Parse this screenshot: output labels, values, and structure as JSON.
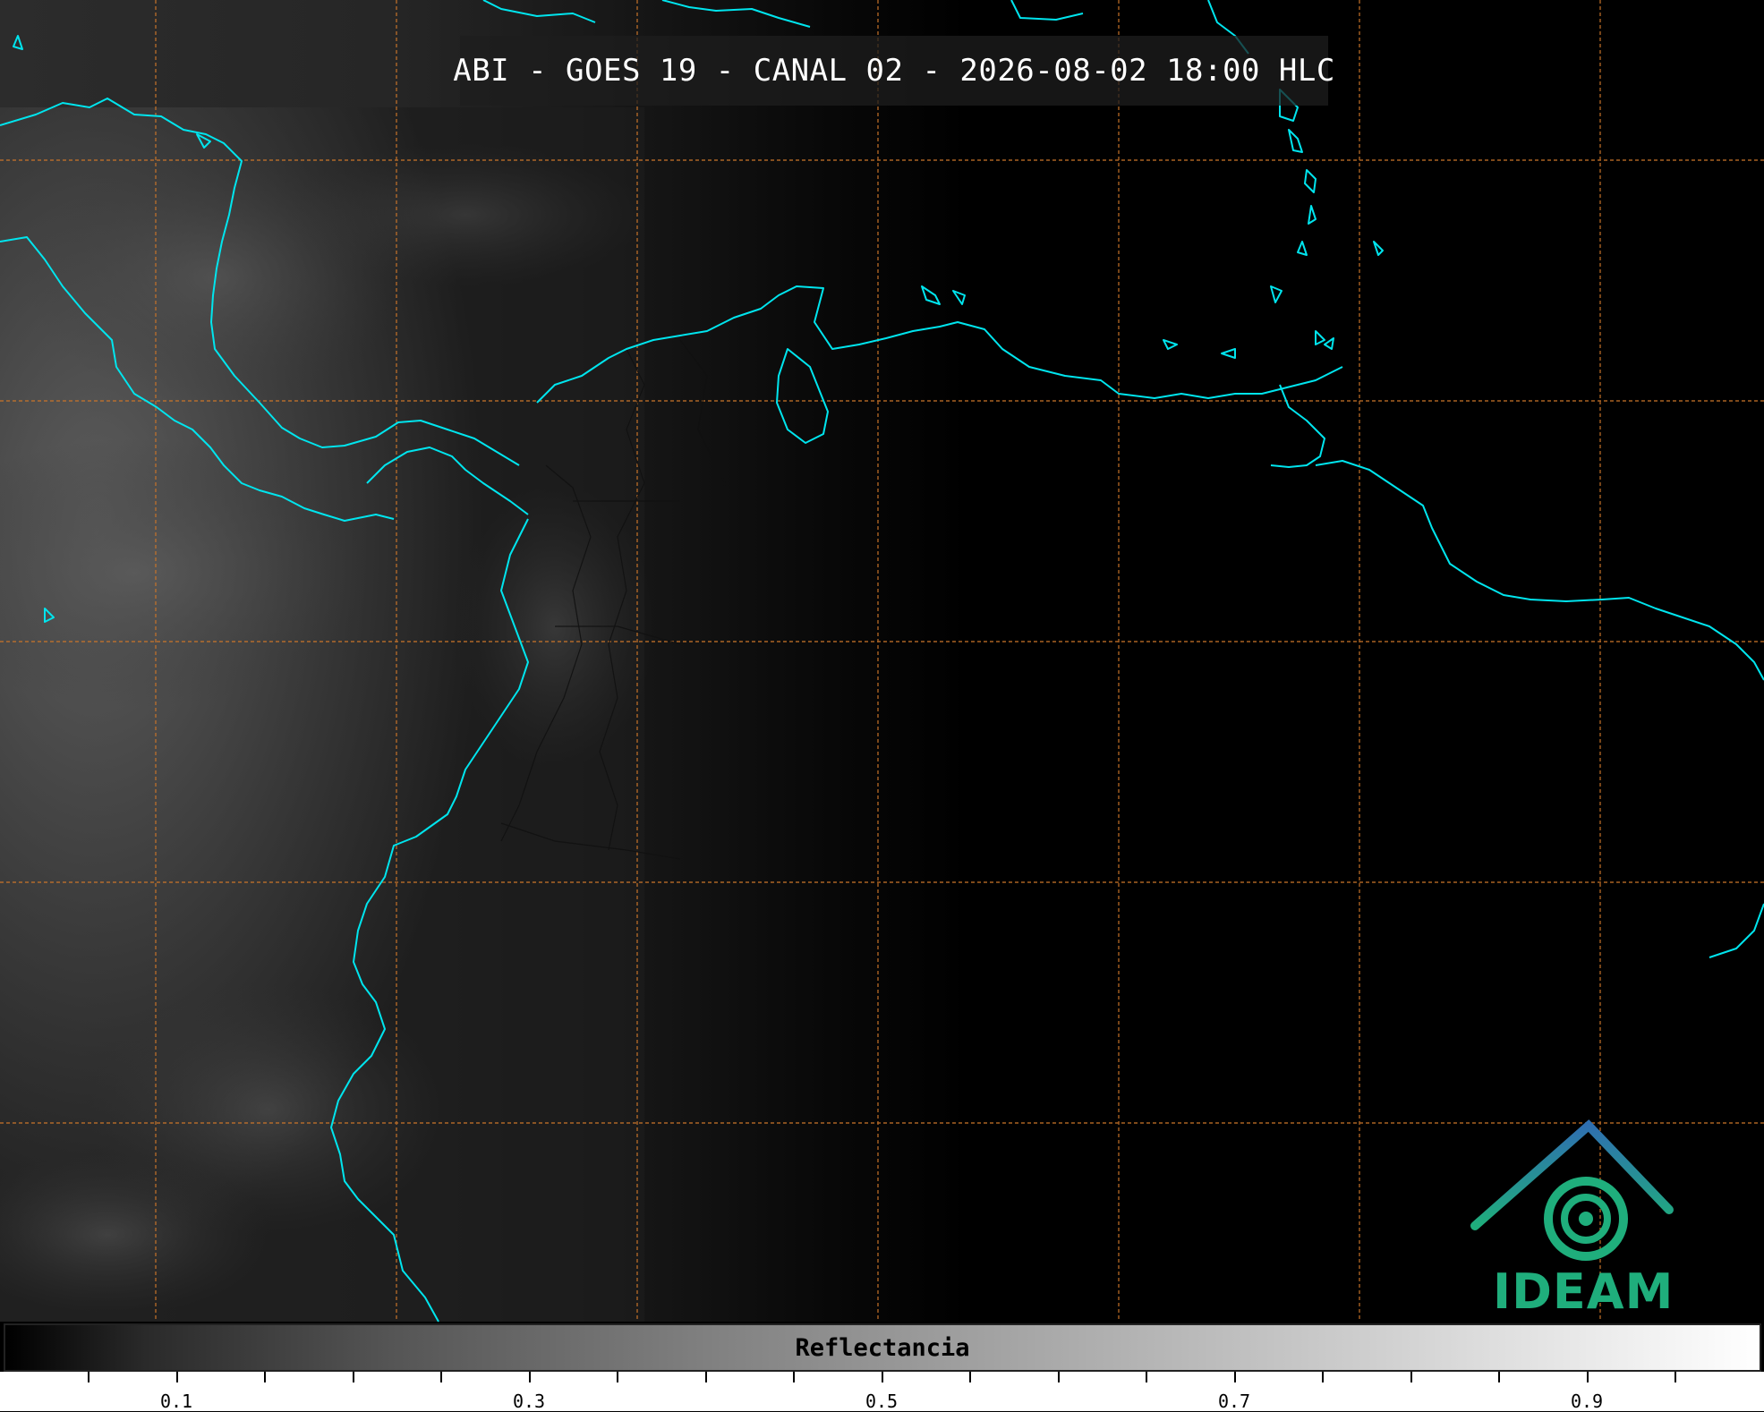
{
  "title": "ABI - GOES 19 - CANAL 02 - 2026-08-02 18:00 HLC",
  "colorbar": {
    "label": "Reflectancia",
    "tick_labels": [
      "0.1",
      "0.3",
      "0.5",
      "0.7",
      "0.9"
    ]
  },
  "logo": {
    "text": "IDEAM"
  },
  "colors": {
    "coastline": "#00e5ee",
    "grid": "#c8742a",
    "background": "#000000",
    "logo_green": "#1fae7c",
    "logo_blue": "#2f6fb0"
  }
}
